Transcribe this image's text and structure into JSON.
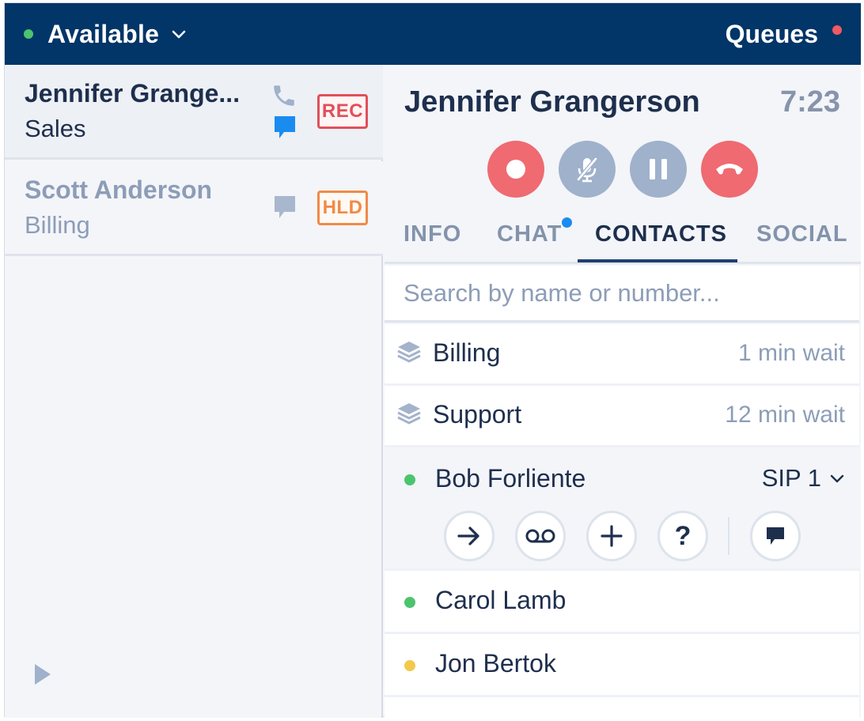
{
  "topbar": {
    "status_label": "Available",
    "status_color": "#4cc46d",
    "queues_label": "Queues",
    "queues_alert_color": "#f05a64"
  },
  "calls": [
    {
      "name": "Jennifer Grange...",
      "department": "Sales",
      "badge": "REC",
      "icons": [
        "phone-icon",
        "chat-bubble-icon"
      ]
    },
    {
      "name": "Scott Anderson",
      "department": "Billing",
      "badge": "HLD",
      "icons": [
        "chat-bubble-icon"
      ]
    }
  ],
  "active_call": {
    "caller_name": "Jennifer Grangerson",
    "timer": "7:23",
    "controls": [
      "record-icon",
      "mute-microphone-icon",
      "pause-icon",
      "hang-up-icon"
    ]
  },
  "tabs": [
    {
      "label": "INFO"
    },
    {
      "label": "CHAT",
      "has_notification": true
    },
    {
      "label": "CONTACTS",
      "active": true
    },
    {
      "label": "SOCIAL"
    }
  ],
  "search": {
    "placeholder": "Search by name or number..."
  },
  "queues": [
    {
      "name": "Billing",
      "wait": "1 min wait"
    },
    {
      "name": "Support",
      "wait": "12 min wait"
    }
  ],
  "contacts": [
    {
      "name": "Bob Forliente",
      "presence": "available",
      "presence_color": "#4cc46d",
      "line": "SIP 1",
      "expanded": true,
      "actions": [
        "transfer-arrow-icon",
        "voicemail-icon",
        "add-plus-icon",
        "help-question-icon",
        "chat-bubble-icon"
      ],
      "help_glyph": "?"
    },
    {
      "name": "Carol Lamb",
      "presence": "available",
      "presence_color": "#4cc46d"
    },
    {
      "name": "Jon Bertok",
      "presence": "away",
      "presence_color": "#f2c94c"
    }
  ]
}
